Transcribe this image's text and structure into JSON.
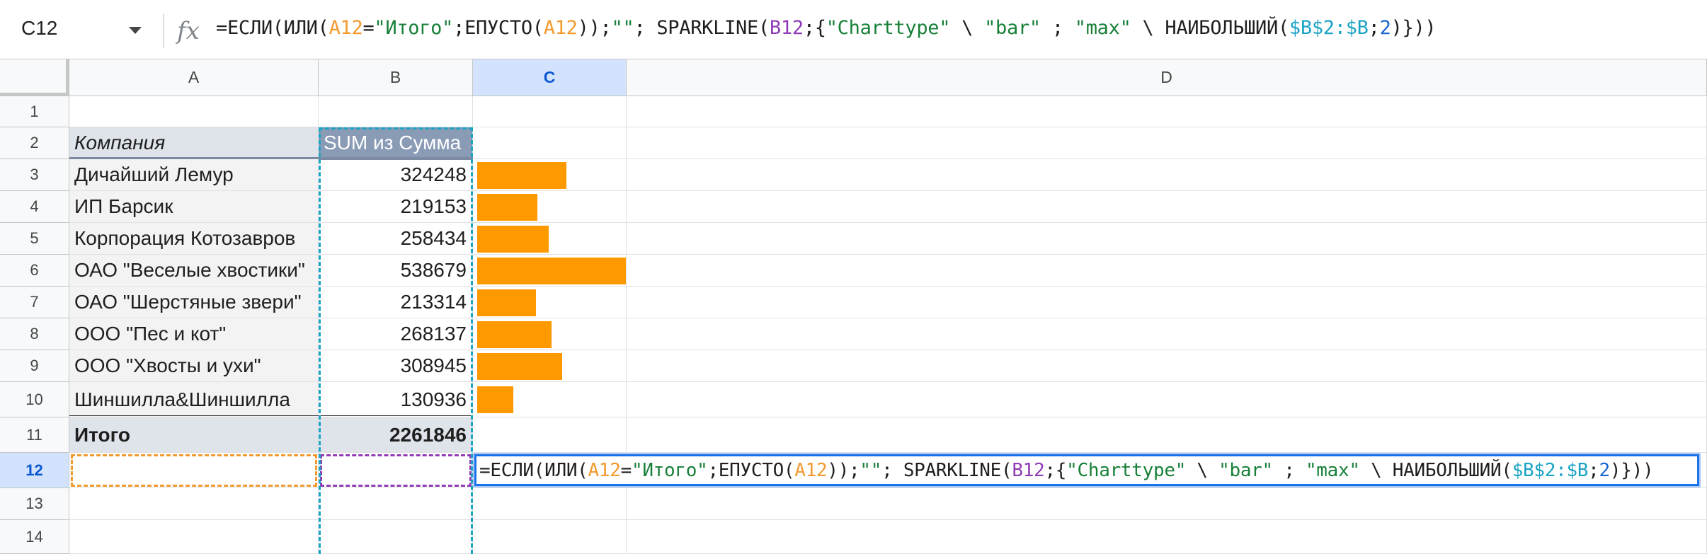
{
  "name_box": {
    "ref": "C12"
  },
  "formula_bar": {
    "fx_glyph": "fx",
    "parts": [
      {
        "t": "=ЕСЛИ(ИЛИ(",
        "c": "black"
      },
      {
        "t": "A12",
        "c": "orange"
      },
      {
        "t": "=",
        "c": "black"
      },
      {
        "t": "\"Итого\"",
        "c": "green"
      },
      {
        "t": ";ЕПУСТО(",
        "c": "black"
      },
      {
        "t": "A12",
        "c": "orange"
      },
      {
        "t": "));",
        "c": "black"
      },
      {
        "t": "\"\"",
        "c": "green"
      },
      {
        "t": "; SPARKLINE(",
        "c": "black"
      },
      {
        "t": "B12",
        "c": "purple"
      },
      {
        "t": ";{",
        "c": "black"
      },
      {
        "t": "\"Charttype\"",
        "c": "green"
      },
      {
        "t": " \\ ",
        "c": "black"
      },
      {
        "t": "\"bar\"",
        "c": "green"
      },
      {
        "t": " ; ",
        "c": "black"
      },
      {
        "t": "\"max\"",
        "c": "green"
      },
      {
        "t": " \\ НАИБОЛЬШИЙ(",
        "c": "black"
      },
      {
        "t": "$B$2:$B",
        "c": "teal"
      },
      {
        "t": ";",
        "c": "black"
      },
      {
        "t": "2",
        "c": "blue"
      },
      {
        "t": ")}))",
        "c": "black"
      }
    ]
  },
  "columns": [
    "A",
    "B",
    "C",
    "D"
  ],
  "selected_column": "C",
  "rows": [
    "1",
    "2",
    "3",
    "4",
    "5",
    "6",
    "7",
    "8",
    "9",
    "10",
    "11",
    "12",
    "13",
    "14"
  ],
  "selected_row": "12",
  "table": {
    "header_company": "Компания",
    "header_sum": "SUM из Сумма",
    "data": [
      {
        "company": "Дичайший Лемур",
        "sum": "324248",
        "value": 324248
      },
      {
        "company": "ИП Барсик",
        "sum": "219153",
        "value": 219153
      },
      {
        "company": "Корпорация Котозавров",
        "sum": "258434",
        "value": 258434
      },
      {
        "company": "ОАО \"Веселые хвостики\"",
        "sum": "538679",
        "value": 538679
      },
      {
        "company": "ОАО \"Шерстяные звери\"",
        "sum": "213314",
        "value": 213314
      },
      {
        "company": "ООО \"Пес и кот\"",
        "sum": "268137",
        "value": 268137
      },
      {
        "company": "ООО \"Хвосты и ухи\"",
        "sum": "308945",
        "value": 308945
      },
      {
        "company": "Шиншилла&Шиншилла",
        "sum": "130936",
        "value": 130936
      }
    ],
    "total_label": "Итого",
    "total_value": "2261846"
  },
  "sparkline": {
    "type": "bar",
    "max": 538679,
    "color": "#ff9900"
  },
  "cell_editor": {
    "parts": [
      {
        "t": "=ЕСЛИ(ИЛИ(",
        "c": "black"
      },
      {
        "t": "A12",
        "c": "orange"
      },
      {
        "t": "=",
        "c": "black"
      },
      {
        "t": "\"Итого\"",
        "c": "green"
      },
      {
        "t": ";ЕПУСТО(",
        "c": "black"
      },
      {
        "t": "A12",
        "c": "orange"
      },
      {
        "t": "));",
        "c": "black"
      },
      {
        "t": "\"\"",
        "c": "green"
      },
      {
        "t": "; SPARKLINE(",
        "c": "black"
      },
      {
        "t": "B12",
        "c": "purple"
      },
      {
        "t": ";{",
        "c": "black"
      },
      {
        "t": "\"Charttype\"",
        "c": "green"
      },
      {
        "t": " \\ ",
        "c": "black"
      },
      {
        "t": "\"bar\"",
        "c": "green"
      },
      {
        "t": " ; ",
        "c": "black"
      },
      {
        "t": "\"max\"",
        "c": "green"
      },
      {
        "t": " \\ НАИБОЛЬШИЙ(",
        "c": "black"
      },
      {
        "t": "$B$2:$B",
        "c": "teal"
      },
      {
        "t": ";",
        "c": "black"
      },
      {
        "t": "2",
        "c": "blue"
      },
      {
        "t": ")}))",
        "c": "black"
      }
    ]
  }
}
